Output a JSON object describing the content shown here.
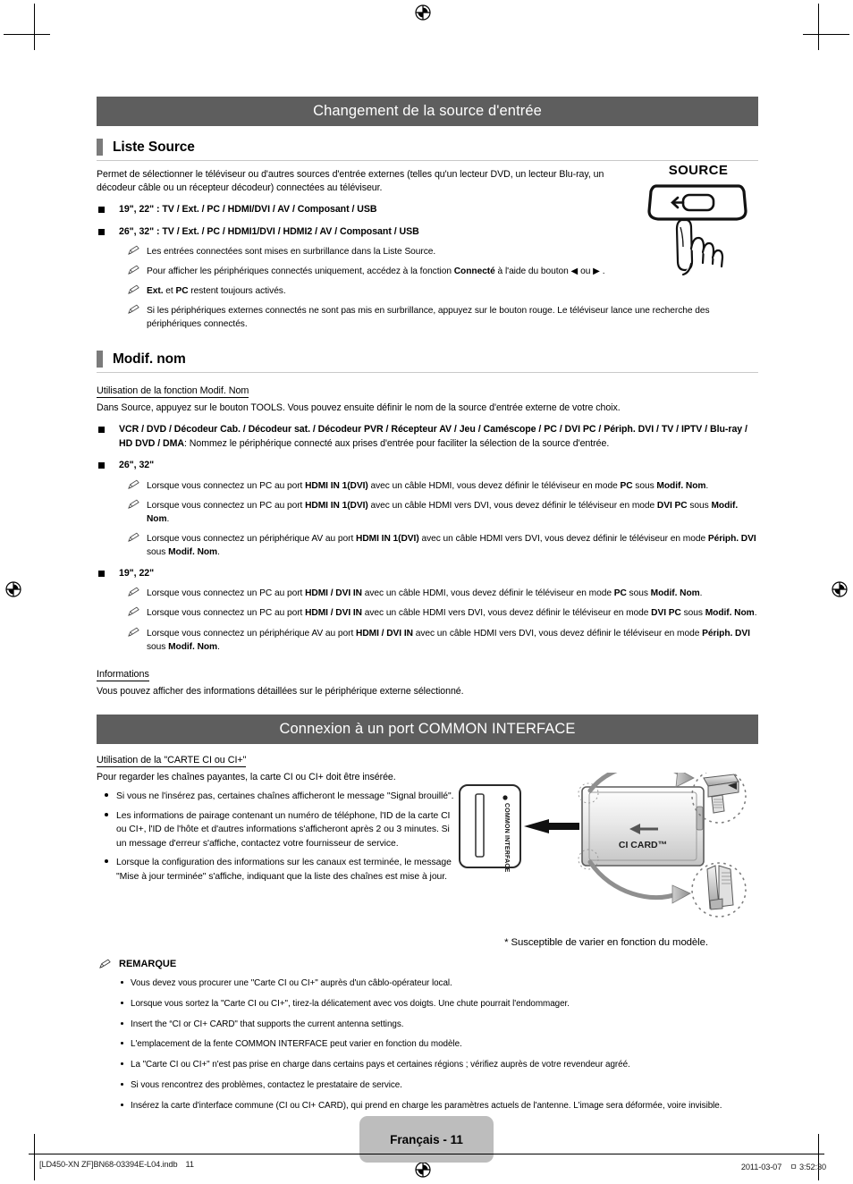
{
  "document": {
    "language_label": "Français - 11",
    "slug_left": "[LD450-XN ZF]BN68-03394E-L04.indb",
    "slug_page": "11",
    "slug_date": "2011-03-07",
    "slug_ampm": "ㅁ",
    "slug_time": "3:52:30"
  },
  "section1": {
    "banner": "Changement de la source d'entrée",
    "sub1": {
      "title": "Liste Source",
      "intro": "Permet de sélectionner le téléviseur ou d'autres sources d'entrée externes (telles qu'un lecteur DVD, un lecteur Blu-ray, un décodeur câble ou un récepteur décodeur) connectées au téléviseur.",
      "bullets": [
        {
          "bold": "19\", 22\" : TV / Ext. / PC / HDMI/DVI / AV / Composant / USB"
        },
        {
          "bold": "26\", 32\" : TV / Ext. / PC / HDMI1/DVI / HDMI2 / AV / Composant / USB"
        }
      ],
      "notes": [
        {
          "parts": [
            {
              "t": "Les entrées connectées sont mises en surbrillance dans la Liste Source.",
              "b": false
            }
          ]
        },
        {
          "parts": [
            {
              "t": "Pour afficher les périphériques connectés uniquement, accédez à la fonction ",
              "b": false
            },
            {
              "t": "Connecté",
              "b": true
            },
            {
              "t": " à l'aide du bouton ◀ ou ▶ .",
              "b": false
            }
          ]
        },
        {
          "parts": [
            {
              "t": "Ext.",
              "b": true
            },
            {
              "t": " et ",
              "b": false
            },
            {
              "t": "PC",
              "b": true
            },
            {
              "t": " restent toujours activés.",
              "b": false
            }
          ]
        },
        {
          "parts": [
            {
              "t": "Si les périphériques externes connectés ne sont pas mis en surbrillance, appuyez sur le bouton rouge. Le téléviseur lance une recherche des périphériques connectés.",
              "b": false
            }
          ]
        }
      ]
    },
    "sub2": {
      "title": "Modif. nom",
      "uhead": "Utilisation de la fonction Modif. Nom",
      "intro": "Dans Source, appuyez sur le bouton TOOLS. Vous pouvez ensuite définir le nom de la source d'entrée externe de votre choix.",
      "bullet_devices_bold": "VCR / DVD / Décodeur Cab. / Décodeur sat. / Décodeur PVR / Récepteur AV / Jeu / Caméscope / PC / DVI PC / Périph. DVI / TV / IPTV / Blu-ray / HD DVD / DMA",
      "bullet_devices_rest": ": Nommez le périphérique connecté aux prises d'entrée pour faciliter la sélection de la source d'entrée.",
      "group_2632_label": "26\", 32\"",
      "group_2632_notes": [
        {
          "parts": [
            {
              "t": "Lorsque vous connectez un PC au port ",
              "b": false
            },
            {
              "t": "HDMI IN 1(DVI)",
              "b": true
            },
            {
              "t": " avec un câble HDMI, vous devez définir le téléviseur en mode ",
              "b": false
            },
            {
              "t": "PC",
              "b": true
            },
            {
              "t": " sous ",
              "b": false
            },
            {
              "t": "Modif. Nom",
              "b": true
            },
            {
              "t": ".",
              "b": false
            }
          ]
        },
        {
          "parts": [
            {
              "t": "Lorsque vous connectez un PC au port ",
              "b": false
            },
            {
              "t": "HDMI IN 1(DVI)",
              "b": true
            },
            {
              "t": " avec un câble HDMI vers DVI, vous devez définir le téléviseur en mode ",
              "b": false
            },
            {
              "t": "DVI PC",
              "b": true
            },
            {
              "t": " sous ",
              "b": false
            },
            {
              "t": "Modif. Nom",
              "b": true
            },
            {
              "t": ".",
              "b": false
            }
          ]
        },
        {
          "parts": [
            {
              "t": "Lorsque vous connectez un périphérique AV au port ",
              "b": false
            },
            {
              "t": "HDMI IN 1(DVI)",
              "b": true
            },
            {
              "t": " avec un câble HDMI vers DVI, vous devez définir le téléviseur en mode ",
              "b": false
            },
            {
              "t": "Périph. DVI",
              "b": true
            },
            {
              "t": " sous ",
              "b": false
            },
            {
              "t": "Modif. Nom",
              "b": true
            },
            {
              "t": ".",
              "b": false
            }
          ]
        }
      ],
      "group_1922_label": "19\", 22\"",
      "group_1922_notes": [
        {
          "parts": [
            {
              "t": "Lorsque vous connectez un PC au port ",
              "b": false
            },
            {
              "t": "HDMI / DVI IN",
              "b": true
            },
            {
              "t": " avec un câble HDMI, vous devez définir le téléviseur en mode ",
              "b": false
            },
            {
              "t": "PC",
              "b": true
            },
            {
              "t": " sous ",
              "b": false
            },
            {
              "t": "Modif. Nom",
              "b": true
            },
            {
              "t": ".",
              "b": false
            }
          ]
        },
        {
          "parts": [
            {
              "t": "Lorsque vous connectez un PC au port ",
              "b": false
            },
            {
              "t": "HDMI / DVI IN",
              "b": true
            },
            {
              "t": " avec un câble HDMI vers DVI, vous devez définir le téléviseur en mode ",
              "b": false
            },
            {
              "t": "DVI PC",
              "b": true
            },
            {
              "t": " sous ",
              "b": false
            },
            {
              "t": "Modif. Nom",
              "b": true
            },
            {
              "t": ".",
              "b": false
            }
          ]
        },
        {
          "parts": [
            {
              "t": "Lorsque vous connectez un périphérique AV au port ",
              "b": false
            },
            {
              "t": "HDMI / DVI IN",
              "b": true
            },
            {
              "t": " avec un câble HDMI vers DVI, vous devez définir le téléviseur en mode ",
              "b": false
            },
            {
              "t": "Périph. DVI",
              "b": true
            },
            {
              "t": " sous ",
              "b": false
            },
            {
              "t": "Modif. Nom",
              "b": true
            },
            {
              "t": ".",
              "b": false
            }
          ]
        }
      ],
      "informations_head": "Informations",
      "informations_text": "Vous pouvez afficher des informations détaillées sur le périphérique externe sélectionné."
    },
    "remote": {
      "button_label": "SOURCE",
      "icon_name": "source-input-icon"
    }
  },
  "section2": {
    "banner": "Connexion à un port COMMON INTERFACE",
    "uhead": "Utilisation de la \"CARTE CI ou CI+\"",
    "intro": "Pour regarder les chaînes payantes, la carte CI ou CI+ doit être insérée.",
    "bullets": [
      "Si vous ne l'insérez pas, certaines chaînes afficheront le message \"Signal brouillé\".",
      "Les informations de pairage contenant un numéro de téléphone, l'ID de la carte CI ou CI+, l'ID de l'hôte et d'autres informations s'afficheront après 2 ou 3 minutes. Si un message d'erreur s'affiche, contactez votre fournisseur de service.",
      "Lorsque la configuration des informations sur les canaux est terminée, le message \"Mise à jour terminée\" s'affiche, indiquant que la liste des chaînes est mise à jour."
    ],
    "remarque_label": "REMARQUE",
    "remarque_items": [
      "Vous devez vous procurer une \"Carte CI ou CI+\" auprès d'un câblo-opérateur local.",
      "Lorsque vous sortez la \"Carte CI ou CI+\", tirez-la délicatement avec vos doigts. Une chute pourrait l'endommager.",
      "Insert the “CI or CI+ CARD\" that supports the current antenna settings.",
      "L'emplacement de la fente COMMON INTERFACE peut varier en fonction du modèle.",
      "La \"Carte CI ou CI+\" n'est pas prise en charge dans certains pays et certaines régions ; vérifiez auprès de votre revendeur agréé.",
      "Si vous rencontrez des problèmes, contactez le prestataire de service.",
      "Insérez la carte d'interface commune (CI ou CI+ CARD), qui prend en charge les paramètres actuels de l'antenne. L'image sera déformée, voire invisible."
    ],
    "diagram": {
      "slot_label": "COMMON INTERFACE",
      "card_label": "CI CARD™",
      "caption": "* Susceptible de varier en fonction du modèle."
    }
  },
  "colors": {
    "banner_bg": "#5e5e5e",
    "subhead_bar": "#7b7b7b",
    "rule": "#c9c9c9",
    "badge_bg": "#bdbdbd"
  }
}
